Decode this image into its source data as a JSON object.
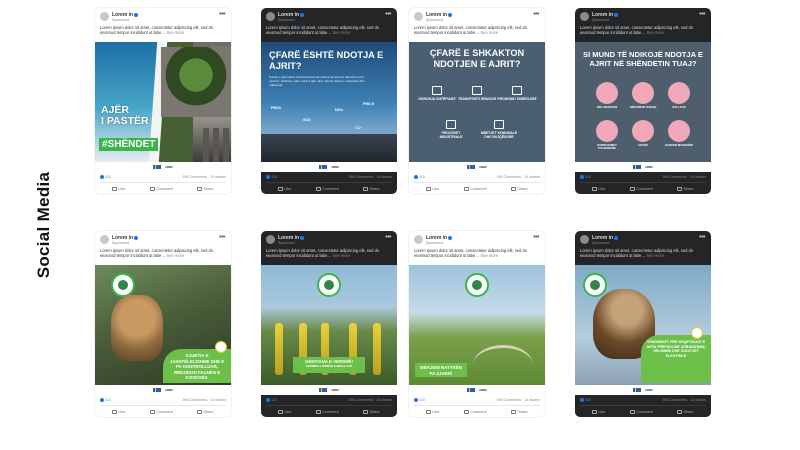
{
  "side_title": "Social Media",
  "post_common": {
    "name": "Lorem in",
    "sponsored": "Sponsored",
    "caption": "Lorem ipsum dolor sit amet, consectetur adipiscing elit, sed do eiusmod tempor incididunt ut labe…",
    "see_more": "See more",
    "likes": "115",
    "comments": "590 Comments · 14 shares",
    "like_label": "Like",
    "comment_label": "Comment",
    "share_label": "Share",
    "logo_text": "AMMK"
  },
  "posts": [
    {
      "theme": "light",
      "title_lines": [
        "AJËR",
        "I PASTËR"
      ],
      "hashtag": "#SHËNDET"
    },
    {
      "theme": "dark",
      "heading": "ÇFARË ËSHTË NDOTJA E AJRIT?",
      "body": "Ndotja e ajrit është substancat në atmosferë që janë të dëmshme për njerëzit, kafshët e ajrit e ajrit a ajër ofrim dëmim kërëm, materialet dhe ndërtesat.",
      "pm_labels": [
        "PM10",
        "SO2",
        "NOx",
        "PM2.5",
        "CO"
      ]
    },
    {
      "theme": "light",
      "heading": "ÇFARË E SHKAKTON NDOTJEN E AJRIT?",
      "items": [
        "NGROHJA SHTËPIAKE",
        "TRANSPORTI RRUGOR",
        "PRODHIMI I ENERGJISË",
        "PROCESET INDUSTRIALE",
        "MBETJET KOMUNALE DHE BUJQËSORE"
      ]
    },
    {
      "theme": "dark",
      "heading": "SI MUND TË NDIKOJË NDOTJA E AJRIT NË SHËNDETIN TUAJ?",
      "items": [
        "INFLAMACIONI",
        "SËMUNDJE DJEGEI",
        "KOLLITJE",
        "KOMPLIKIMET PULMONARE",
        "ASTMA",
        "KANCER MUSHKËRI"
      ]
    },
    {
      "theme": "light",
      "box_text": "GJUETIA E JASHTËLIGJSHME DHE E PA KONTROLLUAR, RREZIKON FAUNËN E KOSOVËS."
    },
    {
      "theme": "dark",
      "box_text": "GENTIANA E VERDHË!",
      "box_sub": "SHEMBULL BIMËSH E RRALLUAR"
    },
    {
      "theme": "light",
      "box_text": "MBAJENI NATYRËN PA ZJARR!"
    },
    {
      "theme": "dark",
      "box_text": "VENDIMIKET PËR SHQIPONJAT E ARTA PËRFSHIJNË URBANIZIMIN, HELMIMIN DHE GODITJET ELEKTRIKE"
    }
  ]
}
